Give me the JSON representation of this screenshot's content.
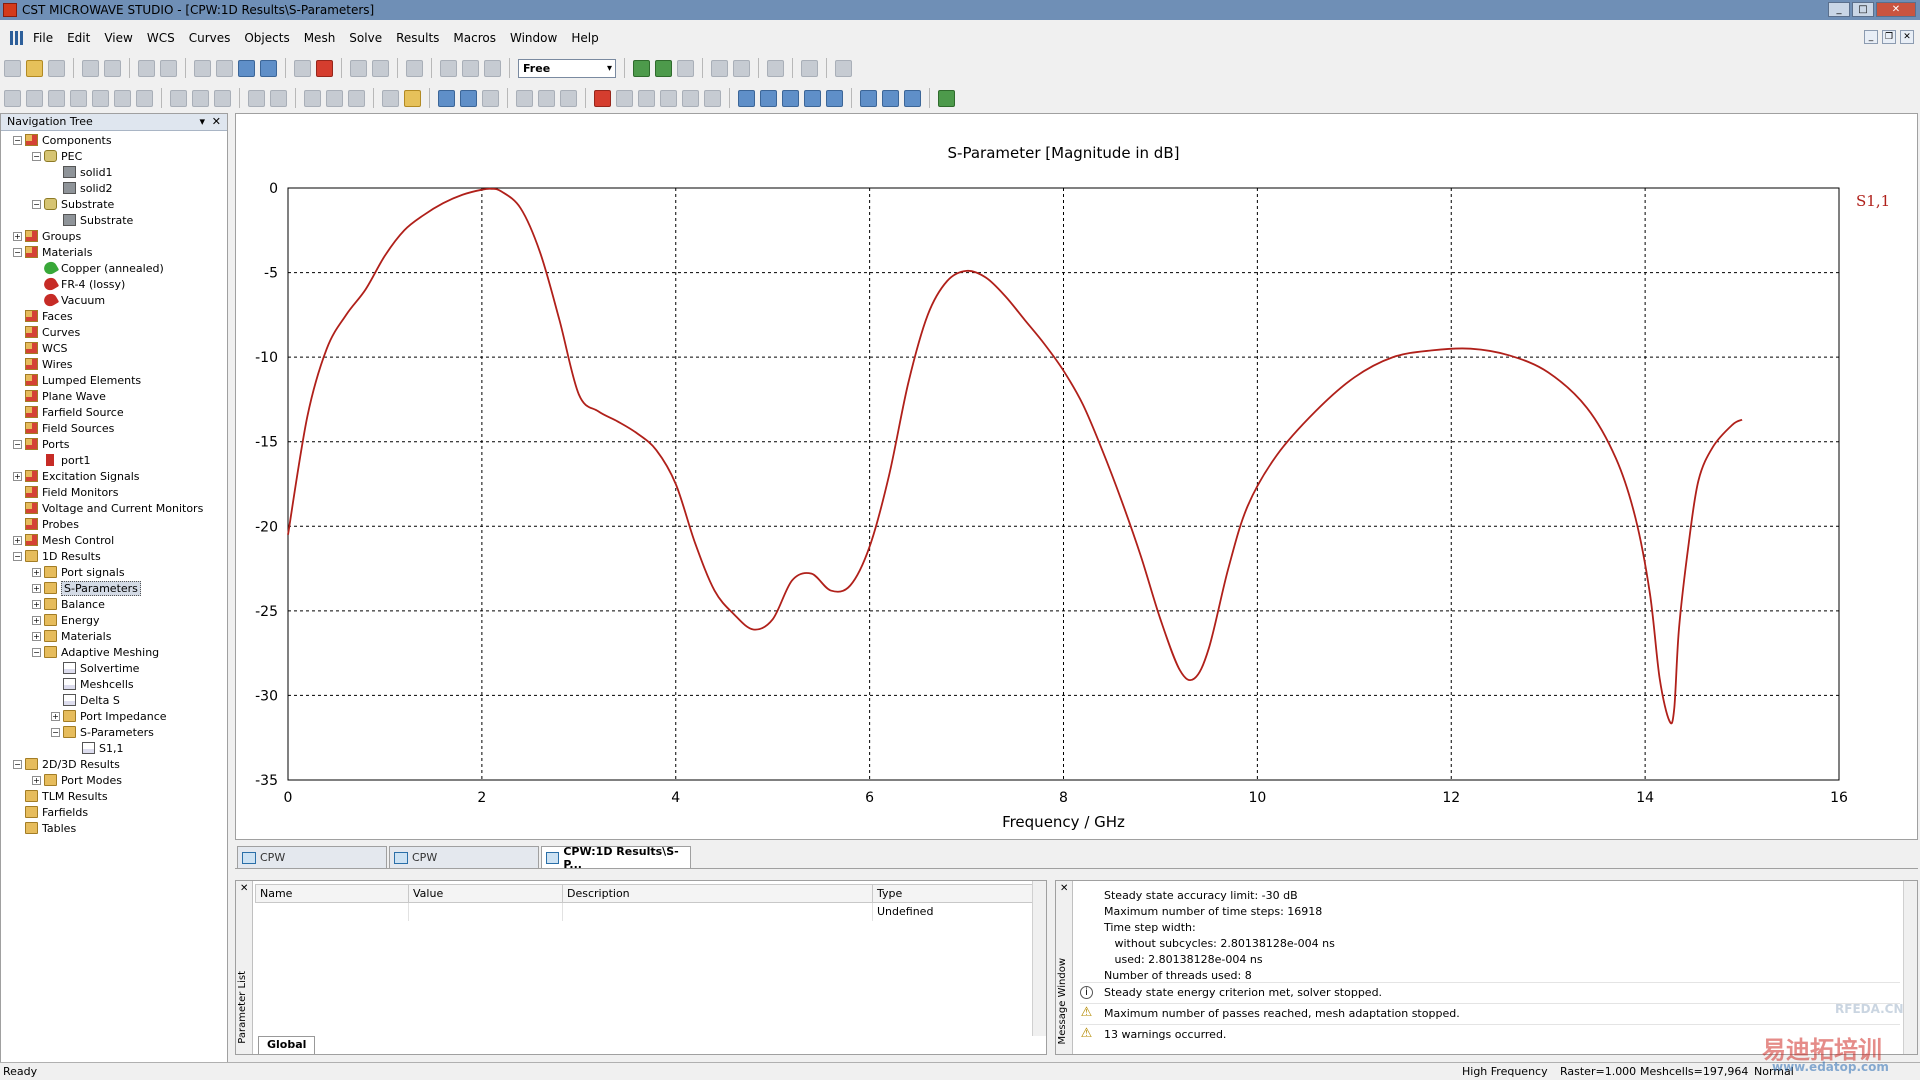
{
  "window": {
    "title": "CST MICROWAVE STUDIO - [CPW:1D Results\\S-Parameters]"
  },
  "menu": [
    "File",
    "Edit",
    "View",
    "WCS",
    "Curves",
    "Objects",
    "Mesh",
    "Solve",
    "Results",
    "Macros",
    "Window",
    "Help"
  ],
  "toolbar": {
    "mode_combo": "Free"
  },
  "nav": {
    "header": "Navigation Tree",
    "items": [
      {
        "label": "Components",
        "level": 0,
        "toggle": "−",
        "icon": "fred"
      },
      {
        "label": "PEC",
        "level": 1,
        "toggle": "−",
        "icon": "pec"
      },
      {
        "label": "solid1",
        "level": 2,
        "toggle": "",
        "icon": "solid"
      },
      {
        "label": "solid2",
        "level": 2,
        "toggle": "",
        "icon": "solid"
      },
      {
        "label": "Substrate",
        "level": 1,
        "toggle": "−",
        "icon": "pec"
      },
      {
        "label": "Substrate",
        "level": 2,
        "toggle": "",
        "icon": "solid"
      },
      {
        "label": "Groups",
        "level": 0,
        "toggle": "+",
        "icon": "fred"
      },
      {
        "label": "Materials",
        "level": 0,
        "toggle": "−",
        "icon": "fred"
      },
      {
        "label": "Copper (annealed)",
        "level": 1,
        "toggle": "",
        "icon": "mgreen"
      },
      {
        "label": "FR-4 (lossy)",
        "level": 1,
        "toggle": "",
        "icon": "mred"
      },
      {
        "label": "Vacuum",
        "level": 1,
        "toggle": "",
        "icon": "mred"
      },
      {
        "label": "Faces",
        "level": 0,
        "toggle": "",
        "icon": "fred"
      },
      {
        "label": "Curves",
        "level": 0,
        "toggle": "",
        "icon": "fred"
      },
      {
        "label": "WCS",
        "level": 0,
        "toggle": "",
        "icon": "fred"
      },
      {
        "label": "Wires",
        "level": 0,
        "toggle": "",
        "icon": "fred"
      },
      {
        "label": "Lumped Elements",
        "level": 0,
        "toggle": "",
        "icon": "fred"
      },
      {
        "label": "Plane Wave",
        "level": 0,
        "toggle": "",
        "icon": "fred"
      },
      {
        "label": "Farfield Source",
        "level": 0,
        "toggle": "",
        "icon": "fred"
      },
      {
        "label": "Field Sources",
        "level": 0,
        "toggle": "",
        "icon": "fred"
      },
      {
        "label": "Ports",
        "level": 0,
        "toggle": "−",
        "icon": "fred"
      },
      {
        "label": "port1",
        "level": 1,
        "toggle": "",
        "icon": "port"
      },
      {
        "label": "Excitation Signals",
        "level": 0,
        "toggle": "+",
        "icon": "fred"
      },
      {
        "label": "Field Monitors",
        "level": 0,
        "toggle": "",
        "icon": "fred"
      },
      {
        "label": "Voltage and Current Monitors",
        "level": 0,
        "toggle": "",
        "icon": "fred"
      },
      {
        "label": "Probes",
        "level": 0,
        "toggle": "",
        "icon": "fred"
      },
      {
        "label": "Mesh Control",
        "level": 0,
        "toggle": "+",
        "icon": "fred"
      },
      {
        "label": "1D Results",
        "level": 0,
        "toggle": "−",
        "icon": "folder"
      },
      {
        "label": "Port signals",
        "level": 1,
        "toggle": "+",
        "icon": "folder"
      },
      {
        "label": "S-Parameters",
        "level": 1,
        "toggle": "+",
        "icon": "folder",
        "selected": true
      },
      {
        "label": "Balance",
        "level": 1,
        "toggle": "+",
        "icon": "folder"
      },
      {
        "label": "Energy",
        "level": 1,
        "toggle": "+",
        "icon": "folder"
      },
      {
        "label": "Materials",
        "level": 1,
        "toggle": "+",
        "icon": "folder"
      },
      {
        "label": "Adaptive Meshing",
        "level": 1,
        "toggle": "−",
        "icon": "folder"
      },
      {
        "label": "Solvertime",
        "level": 2,
        "toggle": "",
        "icon": "graph"
      },
      {
        "label": "Meshcells",
        "level": 2,
        "toggle": "",
        "icon": "graph"
      },
      {
        "label": "Delta S",
        "level": 2,
        "toggle": "",
        "icon": "graph"
      },
      {
        "label": "Port Impedance",
        "level": 2,
        "toggle": "+",
        "icon": "folder"
      },
      {
        "label": "S-Parameters",
        "level": 2,
        "toggle": "−",
        "icon": "folder"
      },
      {
        "label": "S1,1",
        "level": 3,
        "toggle": "",
        "icon": "graph"
      },
      {
        "label": "2D/3D Results",
        "level": 0,
        "toggle": "−",
        "icon": "folder"
      },
      {
        "label": "Port Modes",
        "level": 1,
        "toggle": "+",
        "icon": "folder"
      },
      {
        "label": "TLM Results",
        "level": 0,
        "toggle": "",
        "icon": "folder"
      },
      {
        "label": "Farfields",
        "level": 0,
        "toggle": "",
        "icon": "folder"
      },
      {
        "label": "Tables",
        "level": 0,
        "toggle": "",
        "icon": "folder"
      }
    ]
  },
  "chart_data": {
    "type": "line",
    "title": "S-Parameter [Magnitude in dB]",
    "xlabel": "Frequency / GHz",
    "ylabel": "",
    "xlim": [
      0,
      16
    ],
    "ylim": [
      -35,
      0
    ],
    "xticks": [
      0,
      2,
      4,
      6,
      8,
      10,
      12,
      14,
      16
    ],
    "yticks": [
      0,
      -5,
      -10,
      -15,
      -20,
      -25,
      -30,
      -35
    ],
    "grid": true,
    "series": [
      {
        "name": "S1,1",
        "color": "#b0201a",
        "x": [
          0,
          0.2,
          0.4,
          0.6,
          0.8,
          1.0,
          1.2,
          1.4,
          1.6,
          1.8,
          2.0,
          2.1,
          2.2,
          2.4,
          2.6,
          2.8,
          3.0,
          3.2,
          3.4,
          3.6,
          3.8,
          4.0,
          4.2,
          4.4,
          4.6,
          4.8,
          5.0,
          5.2,
          5.4,
          5.6,
          5.8,
          6.0,
          6.2,
          6.4,
          6.6,
          6.8,
          7.0,
          7.2,
          7.4,
          7.6,
          7.8,
          8.0,
          8.2,
          8.4,
          8.6,
          8.8,
          9.0,
          9.2,
          9.35,
          9.5,
          9.7,
          9.9,
          10.2,
          10.6,
          11.0,
          11.4,
          11.8,
          12.2,
          12.6,
          13.0,
          13.4,
          13.7,
          13.9,
          14.05,
          14.15,
          14.25,
          14.3,
          14.35,
          14.45,
          14.55,
          14.7,
          14.9,
          15.0
        ],
        "y": [
          -20.5,
          -13.5,
          -9.5,
          -7.5,
          -6,
          -4,
          -2.5,
          -1.6,
          -0.9,
          -0.4,
          -0.1,
          -0.05,
          -0.2,
          -1.2,
          -3.8,
          -7.8,
          -12.2,
          -13.2,
          -13.8,
          -14.5,
          -15.5,
          -17.5,
          -21,
          -23.8,
          -25.2,
          -26.1,
          -25.5,
          -23.2,
          -22.8,
          -23.8,
          -23.5,
          -21.2,
          -17,
          -11.5,
          -7.5,
          -5.5,
          -4.9,
          -5.3,
          -6.4,
          -7.8,
          -9.2,
          -10.8,
          -12.8,
          -15.5,
          -18.5,
          -21.8,
          -25.5,
          -28.5,
          -29,
          -27.2,
          -22.5,
          -18.8,
          -15.8,
          -13.2,
          -11.2,
          -10,
          -9.6,
          -9.5,
          -9.9,
          -10.9,
          -13,
          -16,
          -19.5,
          -24,
          -29,
          -31.5,
          -30.8,
          -26,
          -21,
          -17.3,
          -15.3,
          -14,
          -13.7
        ]
      }
    ],
    "legend": "top-right"
  },
  "tabs": [
    {
      "label": "CPW"
    },
    {
      "label": "CPW"
    },
    {
      "label": "CPW:1D Results\\S-P..."
    }
  ],
  "params": {
    "caption": "Parameter List",
    "columns": [
      "Name",
      "/",
      "Value",
      "Description",
      "Type"
    ],
    "rows": [
      {
        "name": "",
        "value": "",
        "description": "",
        "type": "Undefined"
      }
    ],
    "sheet_tab": "Global"
  },
  "messages": {
    "caption": "Message Window",
    "block": [
      "Steady state accuracy limit: -30 dB",
      "Maximum number of time steps: 16918",
      "Time step width:",
      "   without subcycles: 2.80138128e-004 ns",
      "   used: 2.80138128e-004 ns",
      "Number of threads used: 8"
    ],
    "events": [
      {
        "type": "info",
        "text": "Steady state energy criterion met, solver stopped."
      },
      {
        "type": "warning",
        "text": "Maximum number of passes reached, mesh adaptation stopped."
      },
      {
        "type": "warning",
        "text": "13 warnings occurred."
      }
    ]
  },
  "status": {
    "left": "Ready",
    "solver": "High Frequency",
    "raster": "Raster=1.000",
    "meshcells": "Meshcells=197,964",
    "normal": "Normal"
  },
  "watermark": {
    "text1": "RFEDA.CN",
    "text2": "易迪拓培训",
    "text3": "www.edatop.com"
  }
}
